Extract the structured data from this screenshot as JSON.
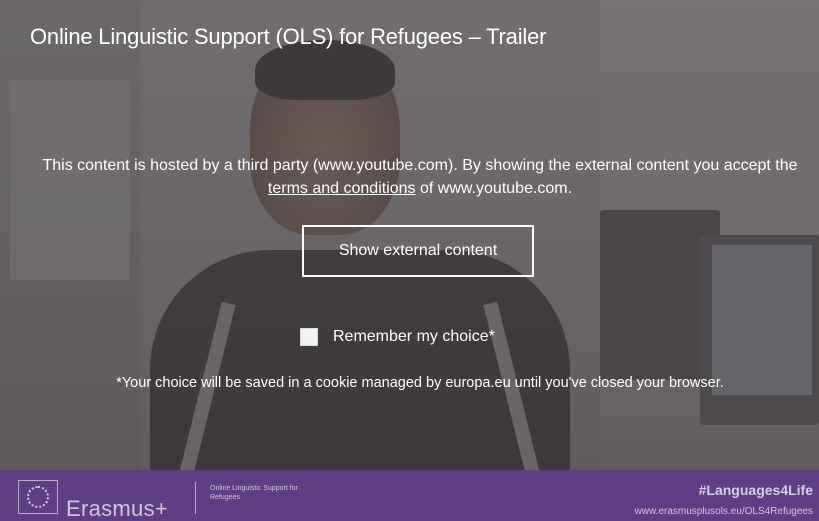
{
  "video": {
    "title": "Online Linguistic Support (OLS) for Refugees – Trailer"
  },
  "consent": {
    "text_before_link": "This content is hosted by a third party (www.youtube.com). By showing the external content you accept the ",
    "link_label": "terms and conditions",
    "text_after_link": " of www.youtube.com.",
    "show_button_label": "Show external content",
    "remember_label": "Remember my choice*",
    "remember_checked": false,
    "cookie_note": "*Your choice will be saved in a cookie managed by europa.eu until you've closed your browser."
  },
  "brand_bar": {
    "program_name": "Erasmus+",
    "ols_lines": "Online Linguistic Support for Refugees",
    "hashtag": "#Languages4Life",
    "url": "www.erasmusplusols.eu/OLS4Refugees"
  },
  "colors": {
    "overlay": "#504a4e",
    "brand_purple": "#5e3f86",
    "text": "#ffffff"
  }
}
